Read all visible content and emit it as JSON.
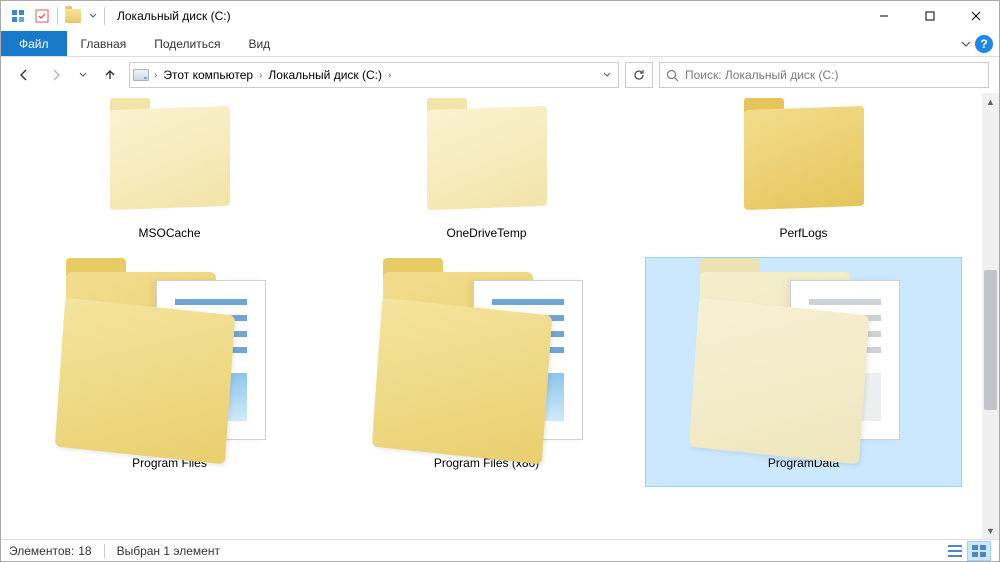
{
  "window": {
    "title": "Локальный диск (C:)"
  },
  "ribbon": {
    "file": "Файл",
    "tabs": [
      "Главная",
      "Поделиться",
      "Вид"
    ]
  },
  "breadcrumbs": {
    "root": "Этот компьютер",
    "current": "Локальный диск (C:)"
  },
  "search": {
    "placeholder": "Поиск: Локальный диск (C:)"
  },
  "items": [
    {
      "name": "MSOCache",
      "kind": "folder-light",
      "selected": false
    },
    {
      "name": "OneDriveTemp",
      "kind": "folder-light",
      "selected": false
    },
    {
      "name": "PerfLogs",
      "kind": "folder-dark",
      "selected": false
    },
    {
      "name": "Program Files",
      "kind": "folder-docs",
      "selected": false
    },
    {
      "name": "Program Files (x86)",
      "kind": "folder-docs",
      "selected": false
    },
    {
      "name": "ProgramData",
      "kind": "folder-docs-pale",
      "selected": true
    }
  ],
  "status": {
    "count_label": "Элементов:",
    "count": "18",
    "selection": "Выбран 1 элемент"
  }
}
